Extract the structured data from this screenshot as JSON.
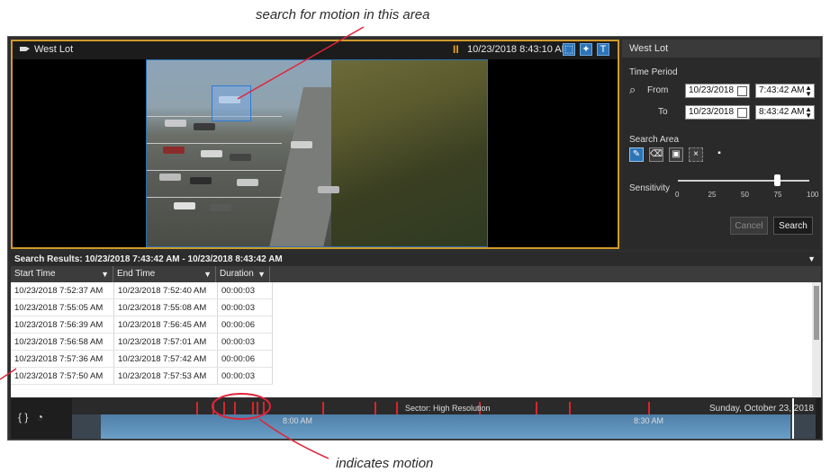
{
  "annotations": {
    "top": "search for motion in this area",
    "bottom": "indicates motion"
  },
  "video": {
    "camera_name": "West Lot",
    "timestamp": "10/23/2018 8:43:10 AM"
  },
  "panel": {
    "title": "West Lot",
    "time_period_label": "Time Period",
    "from_label": "From",
    "from_date": "10/23/2018",
    "from_time": "7:43:42 AM",
    "to_label": "To",
    "to_date": "10/23/2018",
    "to_time": "8:43:42 AM",
    "search_area_label": "Search Area",
    "sensitivity_label": "Sensitivity",
    "sensitivity_ticks": [
      "0",
      "25",
      "50",
      "75",
      "100"
    ],
    "sensitivity_value": 75,
    "cancel_label": "Cancel",
    "search_label": "Search"
  },
  "results": {
    "header": "Search Results: 10/23/2018 7:43:42 AM - 10/23/2018 8:43:42 AM",
    "columns": [
      "Start Time",
      "End Time",
      "Duration"
    ],
    "rows": [
      [
        "10/23/2018 7:52:37 AM",
        "10/23/2018 7:52:40 AM",
        "00:00:03"
      ],
      [
        "10/23/2018 7:55:05 AM",
        "10/23/2018 7:55:08 AM",
        "00:00:03"
      ],
      [
        "10/23/2018 7:56:39 AM",
        "10/23/2018 7:56:45 AM",
        "00:00:06"
      ],
      [
        "10/23/2018 7:56:58 AM",
        "10/23/2018 7:57:01 AM",
        "00:00:03"
      ],
      [
        "10/23/2018 7:57:36 AM",
        "10/23/2018 7:57:42 AM",
        "00:00:06"
      ],
      [
        "10/23/2018 7:57:50 AM",
        "10/23/2018 7:57:53 AM",
        "00:00:03"
      ]
    ]
  },
  "timeline": {
    "sector_label": "Sector: High Resolution",
    "date_label": "Sunday, October 23, 2018",
    "time_labels": [
      "8:00 AM",
      "8:30 AM"
    ]
  },
  "colors": {
    "accent": "#2b74b8",
    "highlight_border": "#d09a2a",
    "motion_mark": "#d9262a",
    "annotation": "#e0233a"
  }
}
